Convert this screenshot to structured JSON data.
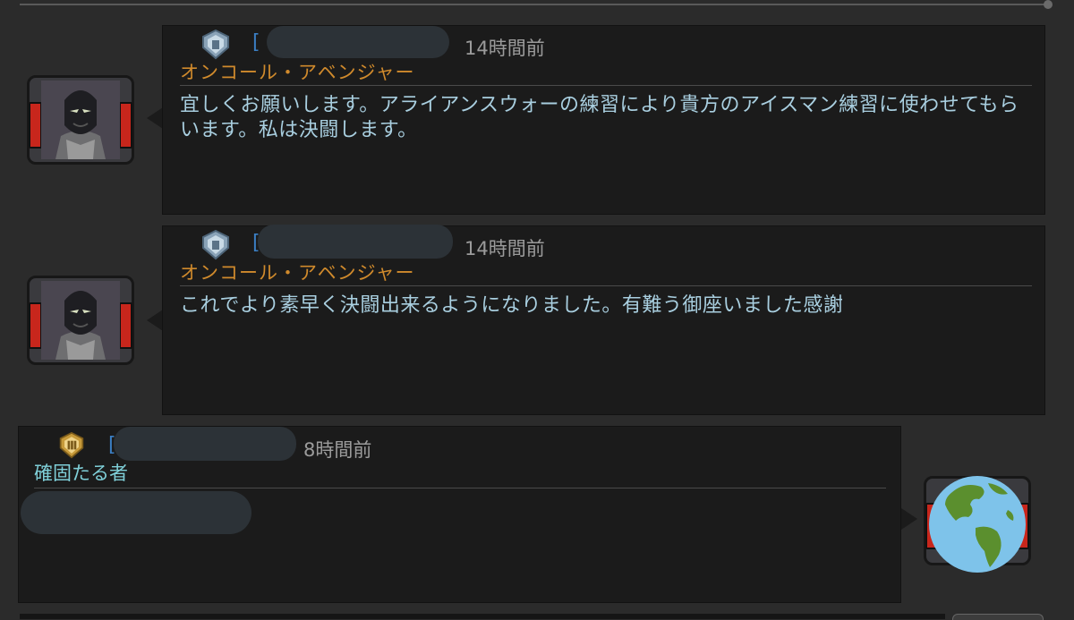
{
  "messages": [
    {
      "user_title": "オンコール・アベンジャー",
      "bracket": "[",
      "time": "14時間前",
      "text": "宜しくお願いします。アライアンスウォーの練習により貴方のアイスマン練習に使わせてもらいます。私は決闘します。"
    },
    {
      "user_title": "オンコール・アベンジャー",
      "bracket": "[",
      "time": "14時間前",
      "text": "これでより素早く決闘出来るようになりました。有難う御座いました感謝"
    },
    {
      "user_title": "確固たる者",
      "bracket": "[",
      "time": "8時間前",
      "text": ""
    }
  ],
  "icons": {
    "avatar_left": "panther-avatar-icon",
    "avatar_right": "earth-globe-icon",
    "rank_1": "platinum-shield-icon",
    "rank_2": "platinum-shield-icon",
    "rank_3": "gold-shield-icon"
  },
  "colors": {
    "title_gold": "#d08a2c",
    "title_teal": "#7fcfd8",
    "message_text": "#a9cfe0",
    "link_blue": "#3b7fc4"
  }
}
